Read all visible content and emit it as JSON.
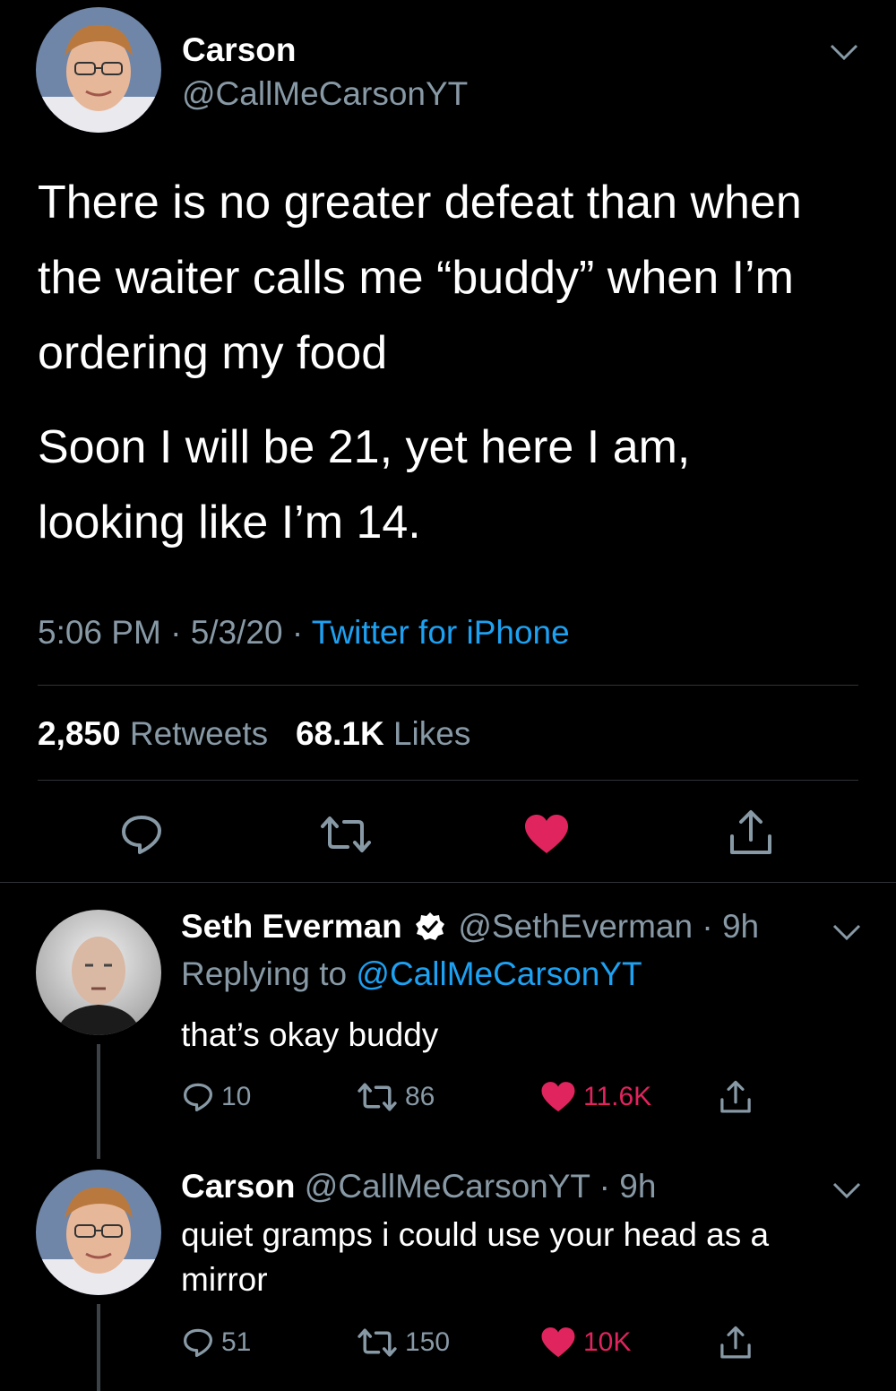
{
  "main_tweet": {
    "author_name": "Carson",
    "author_handle": "@CallMeCarsonYT",
    "paragraph1_line1": "There is no greater defeat than when",
    "paragraph1_line2": "the waiter calls me “buddy” when I’m",
    "paragraph1_line3": "ordering my food",
    "paragraph2_line1": "Soon I will be 21, yet here I am,",
    "paragraph2_line2": "looking like I’m 14.",
    "time": "5:06 PM",
    "date": "5/3/20",
    "source": "Twitter for iPhone",
    "retweets_count": "2,850",
    "retweets_label": "Retweets",
    "likes_count": "68.1K",
    "likes_label": "Likes"
  },
  "replies": [
    {
      "author_name": "Seth Everman",
      "author_handle": "@SethEverman",
      "age": "9h",
      "replying_label": "Replying to",
      "replying_to": "@CallMeCarsonYT",
      "text": "that’s okay buddy",
      "reply_count": "10",
      "retweet_count": "86",
      "like_count": "11.6K"
    },
    {
      "author_name": "Carson",
      "author_handle": "@CallMeCarsonYT",
      "age": "9h",
      "text_line1": "quiet gramps i could use your head as a",
      "text_line2": "mirror",
      "reply_count": "51",
      "retweet_count": "150",
      "like_count": "10K"
    }
  ],
  "separator": "·",
  "colors": {
    "background": "#000000",
    "secondary_text": "#8899a6",
    "link": "#1da1f2",
    "like": "#e0245e"
  },
  "icons": [
    "chevron-down-icon",
    "reply-icon",
    "retweet-icon",
    "heart-icon",
    "share-icon",
    "verified-badge-icon"
  ]
}
